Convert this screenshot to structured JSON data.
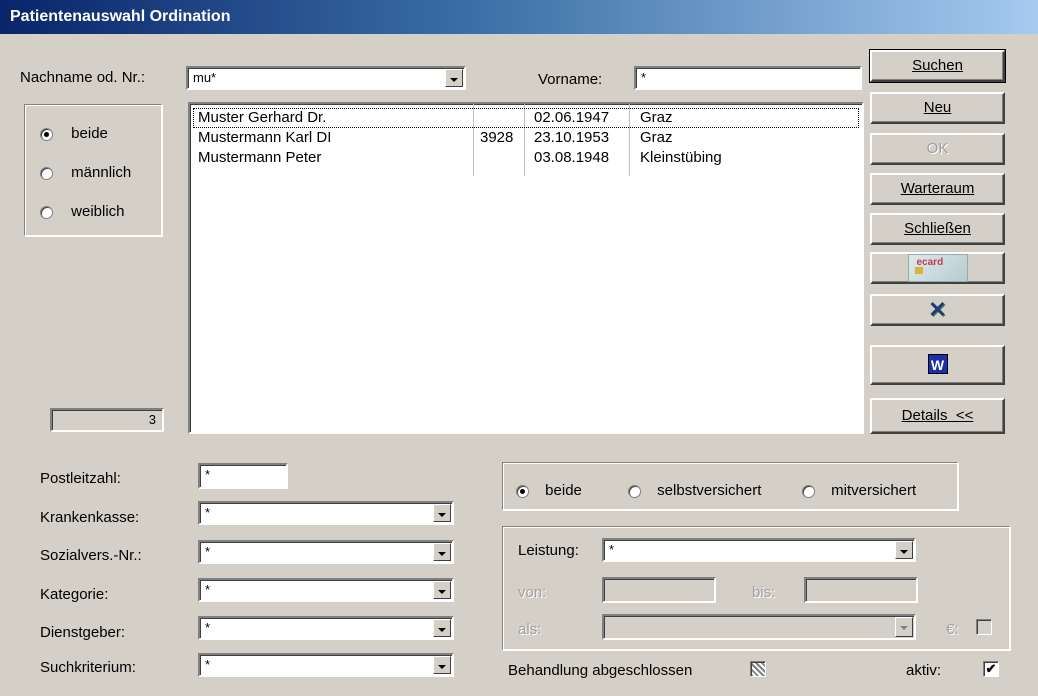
{
  "window": {
    "title": "Patientenauswahl Ordination"
  },
  "search": {
    "lastname_label": "Nachname od. Nr.:",
    "lastname_value": "mu*",
    "firstname_label": "Vorname:",
    "firstname_value": "*"
  },
  "gender": {
    "options": [
      "beide",
      "männlich",
      "weiblich"
    ],
    "selected": "beide"
  },
  "count": "3",
  "results": [
    {
      "name": "Muster Gerhard Dr.",
      "nr": "",
      "birth": "02.06.1947",
      "place": "Graz"
    },
    {
      "name": "Mustermann Karl DI",
      "nr": "3928",
      "birth": "23.10.1953",
      "place": "Graz"
    },
    {
      "name": "Mustermann Peter",
      "nr": "",
      "birth": "03.08.1948",
      "place": "Kleinstübing"
    }
  ],
  "buttons": {
    "suchen": "Suchen",
    "neu": "Neu",
    "ok": "OK",
    "warteraum": "Warteraum",
    "schliessen": "Schließen",
    "ecard": "ecard",
    "details": "Details  <<"
  },
  "filters": {
    "postleitzahl": {
      "label": "Postleitzahl:",
      "value": "*"
    },
    "krankenkasse": {
      "label": "Krankenkasse:",
      "value": "*"
    },
    "sozialvers": {
      "label": "Sozialvers.-Nr.:",
      "value": "*"
    },
    "kategorie": {
      "label": "Kategorie:",
      "value": "*"
    },
    "dienstgeber": {
      "label": "Dienstgeber:",
      "value": "*"
    },
    "suchkriterium": {
      "label": "Suchkriterium:",
      "value": "*"
    }
  },
  "insurance": {
    "options": [
      "beide",
      "selbstversichert",
      "mitversichert"
    ],
    "selected": "beide"
  },
  "leistung": {
    "label": "Leistung:",
    "value": "*",
    "von_label": "von:",
    "bis_label": "bis:",
    "als_label": "als:",
    "euro_label": "€:"
  },
  "status": {
    "behandlung_label": "Behandlung abgeschlossen",
    "aktiv_label": "aktiv:",
    "aktiv_check": "✔"
  }
}
